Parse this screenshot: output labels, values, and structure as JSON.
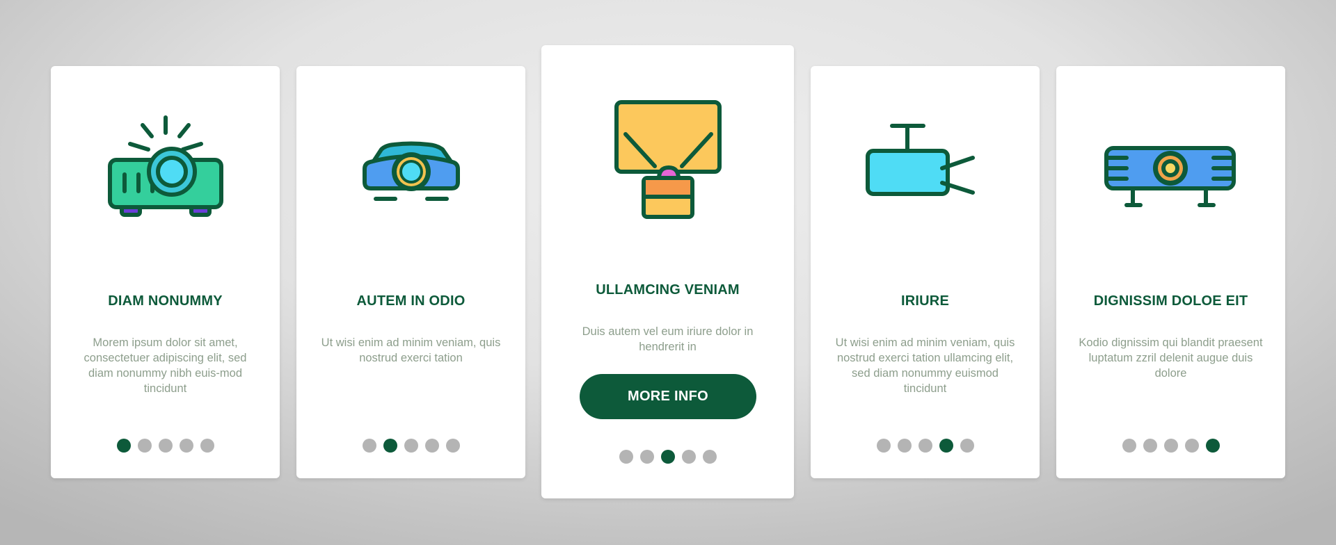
{
  "colors": {
    "primary": "#0d5a3a",
    "description_text": "#8d9e8c",
    "dot_inactive": "#b4b4b4",
    "card_background": "#ffffff"
  },
  "cards": [
    {
      "icon": "projector-with-light-rays-icon",
      "title": "DIAM NONUMMY",
      "description": "Morem ipsum dolor sit amet, consectetuer adipiscing elit, sed diam nonummy nibh euis-mod tincidunt",
      "active_page": 1,
      "total_pages": 5
    },
    {
      "icon": "home-cinema-projector-icon",
      "title": "AUTEM IN ODIO",
      "description": "Ut wisi enim ad minim veniam, quis nostrud exerci tation",
      "active_page": 2,
      "total_pages": 5
    },
    {
      "icon": "projector-and-screen-icon",
      "title": "ULLAMCING VENIAM",
      "description": "Duis autem vel eum iriure dolor in hendrerit in",
      "button_label": "MORE INFO",
      "active_page": 3,
      "total_pages": 5
    },
    {
      "icon": "ceiling-mounted-projector-icon",
      "title": "IRIURE",
      "description": "Ut wisi enim ad minim veniam, quis nostrud exerci tation ullamcing elit, sed diam nonummy euismod tincidunt",
      "active_page": 4,
      "total_pages": 5
    },
    {
      "icon": "wide-projector-on-stand-icon",
      "title": "DIGNISSIM DOLOE EIT",
      "description": "Kodio dignissim qui blandit praesent luptatum zzril delenit augue duis dolore",
      "active_page": 5,
      "total_pages": 5
    }
  ]
}
